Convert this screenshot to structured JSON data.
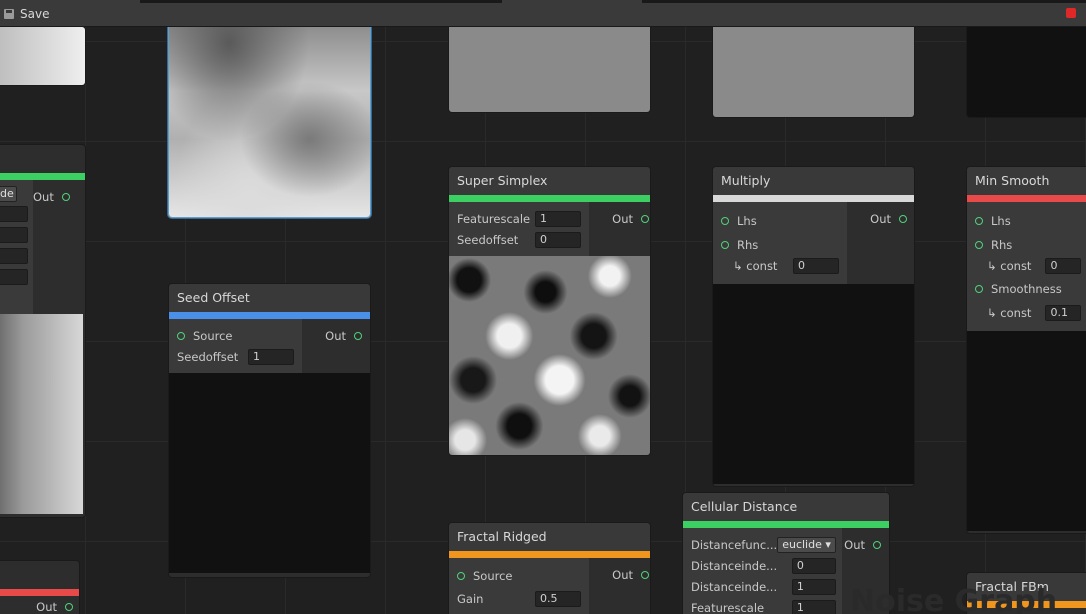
{
  "toolbar": {
    "save_label": "Save"
  },
  "watermark": "Noise Graph",
  "colors": {
    "green": "#3ccf61",
    "blue": "#4a90e8",
    "orange": "#f0961e",
    "red": "#e84a4a",
    "white": "#d8d8d8"
  },
  "nodes": {
    "left": {
      "dropdown": "de",
      "out": "Out"
    },
    "seed_offset": {
      "title": "Seed Offset",
      "source": "Source",
      "seedoffset_label": "Seedoffset",
      "seedoffset_value": "1",
      "out": "Out"
    },
    "super_simplex": {
      "title": "Super Simplex",
      "featurescale_label": "Featurescale",
      "featurescale_value": "1",
      "seedoffset_label": "Seedoffset",
      "seedoffset_value": "0",
      "out": "Out"
    },
    "multiply": {
      "title": "Multiply",
      "lhs": "Lhs",
      "rhs": "Rhs",
      "const_label": "↳ const",
      "const_value": "0",
      "out": "Out"
    },
    "min_smooth": {
      "title": "Min Smooth",
      "lhs": "Lhs",
      "rhs": "Rhs",
      "const_label": "↳ const",
      "const_value": "0",
      "smoothness": "Smoothness",
      "smooth_const_label": "↳ const",
      "smooth_const_value": "0.1"
    },
    "fractal_ridged": {
      "title": "Fractal Ridged",
      "source": "Source",
      "gain_label": "Gain",
      "gain_value": "0.5",
      "out": "Out"
    },
    "cellular_distance": {
      "title": "Cellular Distance",
      "df_label": "Distancefunc...",
      "df_value": "euclide",
      "di0_label": "Distanceinde...",
      "di0_value": "0",
      "di1_label": "Distanceinde...",
      "di1_value": "1",
      "fs_label": "Featurescale",
      "fs_value": "1",
      "out": "Out"
    },
    "fractal_fbm": {
      "title": "Fractal FBm"
    }
  }
}
